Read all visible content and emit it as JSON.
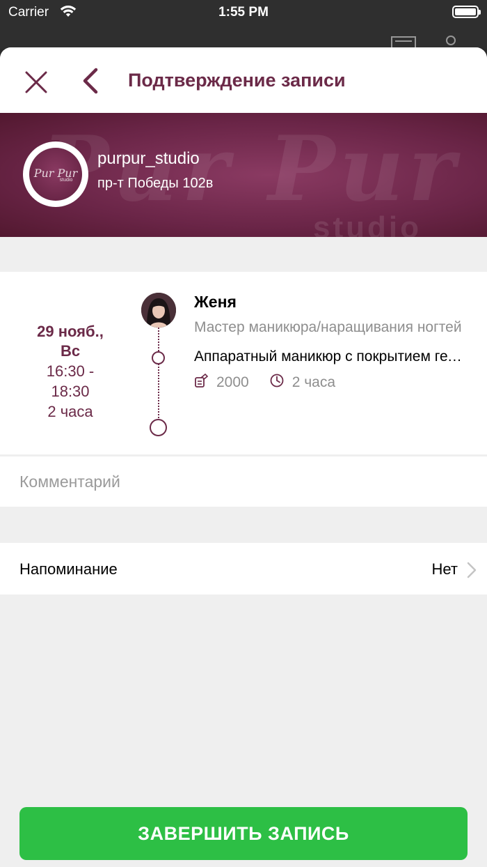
{
  "status_bar": {
    "carrier": "Carrier",
    "time": "1:55 PM"
  },
  "header": {
    "title": "Подтверждение записи"
  },
  "studio": {
    "name": "purpur_studio",
    "address": "пр-т Победы 102в",
    "logo_text": "Pur Pur",
    "logo_sub": "studio"
  },
  "appointment": {
    "date": "29 нояб.,",
    "weekday": "Вс",
    "time_range_start": "16:30 -",
    "time_range_end": "18:30",
    "duration": "2 часа",
    "master_name": "Женя",
    "master_role": "Мастер маникюра/наращивания ногтей",
    "service_name": "Аппаратный маникюр с покрытием гель-лаком",
    "service_price": "2000",
    "service_duration": "2 часа",
    "total_price": "2000"
  },
  "comment": {
    "placeholder": "Комментарий"
  },
  "reminder": {
    "label": "Напоминание",
    "value": "Нет"
  },
  "submit": {
    "label": "ЗАВЕРШИТЬ ЗАПИСЬ"
  },
  "colors": {
    "accent": "#6b2a48",
    "submit": "#2dbf45",
    "muted": "#8e8e8e"
  }
}
